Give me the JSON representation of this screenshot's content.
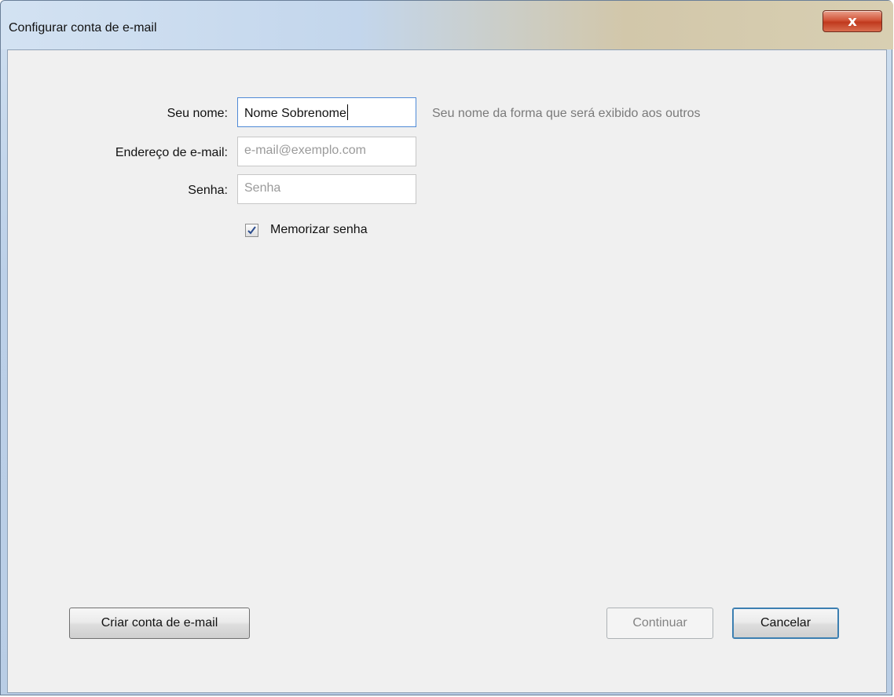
{
  "window": {
    "title": "Configurar conta de e-mail",
    "close_label": "x"
  },
  "form": {
    "name_label": "Seu nome:",
    "name_value": "Nome Sobrenome",
    "name_hint": "Seu nome da forma que será exibido aos outros",
    "email_label": "Endereço de e-mail:",
    "email_placeholder": "e-mail@exemplo.com",
    "password_label": "Senha:",
    "password_placeholder": "Senha",
    "remember_label": "Memorizar senha",
    "remember_checked": true
  },
  "buttons": {
    "create_account": "Criar conta de e-mail",
    "continue": "Continuar",
    "cancel": "Cancelar"
  },
  "icons": {
    "close": "close-icon",
    "checkmark": "checkmark-icon"
  }
}
